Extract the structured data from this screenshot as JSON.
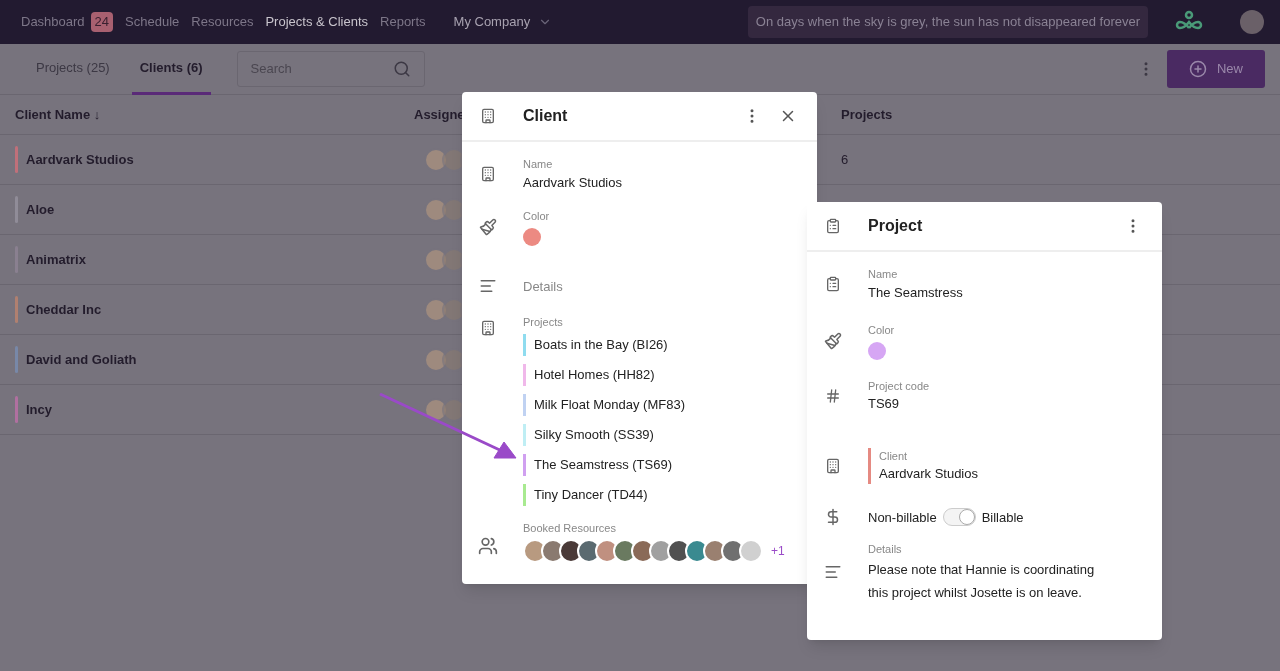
{
  "nav": {
    "items": [
      {
        "label": "Dashboard",
        "badge": "24",
        "selected": false
      },
      {
        "label": "Schedule",
        "selected": false
      },
      {
        "label": "Resources",
        "selected": false
      },
      {
        "label": "Projects & Clients",
        "selected": true
      },
      {
        "label": "Reports",
        "selected": false
      }
    ],
    "company": "My Company",
    "quote": "On days when the sky is grey, the sun has not disappeared forever"
  },
  "tabs": [
    {
      "label": "Projects (25)",
      "selected": false
    },
    {
      "label": "Clients (6)",
      "selected": true
    }
  ],
  "search": {
    "placeholder": "Search"
  },
  "new_button": "New",
  "table": {
    "columns": [
      "Client Name ↓",
      "Assigne",
      "Projects"
    ],
    "rows": [
      {
        "name": "Aardvark Studios",
        "color": "#c0707a",
        "projects": "6"
      },
      {
        "name": "Aloe",
        "color": "#908c98"
      },
      {
        "name": "Animatrix",
        "color": "#8a8090"
      },
      {
        "name": "Cheddar Inc",
        "color": "#b08070"
      },
      {
        "name": "David and Goliath",
        "color": "#7888a8"
      },
      {
        "name": "Incy",
        "color": "#b070a0"
      }
    ]
  },
  "client_dialog": {
    "title": "Client",
    "name_label": "Name",
    "name": "Aardvark Studios",
    "color_label": "Color",
    "color": "#ec8a82",
    "details": "Details",
    "projects_label": "Projects",
    "projects": [
      {
        "label": "Boats in the Bay (BI26)",
        "color": "#8fdcef"
      },
      {
        "label": "Hotel Homes (HH82)",
        "color": "#f0b8ea"
      },
      {
        "label": "Milk Float Monday (MF83)",
        "color": "#c0d2f2"
      },
      {
        "label": "Silky Smooth (SS39)",
        "color": "#bfeef4"
      },
      {
        "label": "The Seamstress (TS69)",
        "color": "#d0a0f0"
      },
      {
        "label": "Tiny Dancer (TD44)",
        "color": "#a8ea90"
      }
    ],
    "resources_label": "Booked Resources",
    "more": "+1"
  },
  "project_dialog": {
    "title": "Project",
    "name_label": "Name",
    "name": "The Seamstress",
    "color_label": "Color",
    "color": "#d6a6f4",
    "code_label": "Project code",
    "code": "TS69",
    "client_label": "Client",
    "client": {
      "name": "Aardvark Studios",
      "color": "#e58a82"
    },
    "billing": {
      "off_label": "Non-billable",
      "on_label": "Billable",
      "on": true
    },
    "details_label": "Details",
    "details": "Please note that Hannie is coordinating this project whilst Josette is on leave."
  }
}
